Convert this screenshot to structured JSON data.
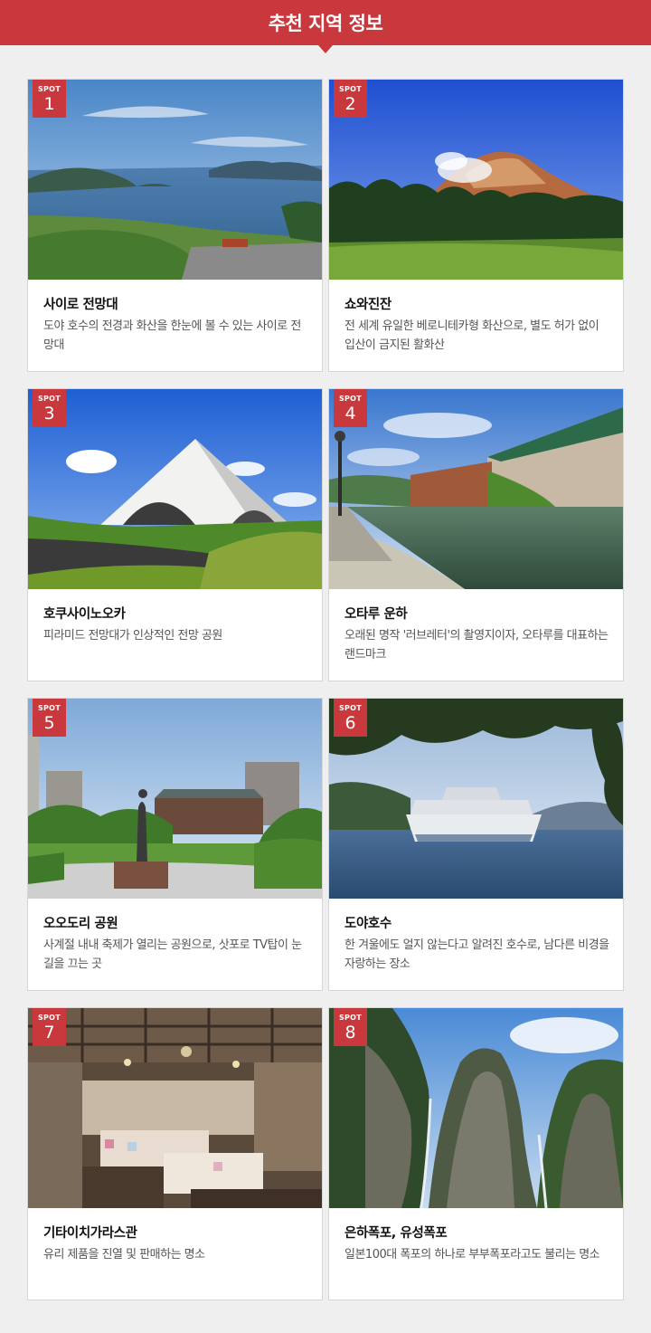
{
  "header": {
    "title": "추천 지역 정보"
  },
  "spots": [
    {
      "badge": "SPOT",
      "number": "1",
      "title": "사이로 전망대",
      "desc": "도야 호수의 전경과 화산을 한눈에 볼 수 있는 사이로 전망대"
    },
    {
      "badge": "SPOT",
      "number": "2",
      "title": "쇼와진잔",
      "desc": "전 세계 유일한 베로니테카형 화산으로, 별도 허가 없이 입산이 금지된 활화산"
    },
    {
      "badge": "SPOT",
      "number": "3",
      "title": "호쿠사이노오카",
      "desc": "피라미드 전망대가 인상적인 전망 공원"
    },
    {
      "badge": "SPOT",
      "number": "4",
      "title": "오타루 운하",
      "desc": "오래된 명작 '러브레터'의 촬영지이자, 오타루를 대표하는 랜드마크"
    },
    {
      "badge": "SPOT",
      "number": "5",
      "title": "오오도리 공원",
      "desc": "사계절 내내 축제가 열리는 공원으로, 삿포로 TV탑이 눈길을 끄는 곳"
    },
    {
      "badge": "SPOT",
      "number": "6",
      "title": "도야호수",
      "desc": "한 겨울에도 얼지 않는다고 알려진 호수로, 남다른 비경을 자랑하는 장소"
    },
    {
      "badge": "SPOT",
      "number": "7",
      "title": "기타이치가라스관",
      "desc": "유리 제품을 진열 및 판매하는 명소"
    },
    {
      "badge": "SPOT",
      "number": "8",
      "title": "은하폭포, 유성폭포",
      "desc": "일본100대 폭포의 하나로 부부폭포라고도 불리는 명소"
    }
  ]
}
